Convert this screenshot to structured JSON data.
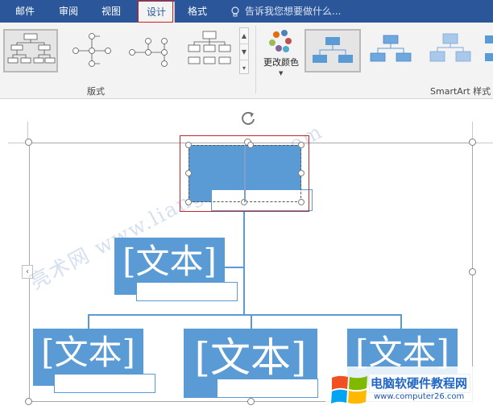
{
  "tabs": [
    {
      "label": "邮件",
      "active": false
    },
    {
      "label": "审阅",
      "active": false
    },
    {
      "label": "视图",
      "active": false
    },
    {
      "label": "设计",
      "active": true
    },
    {
      "label": "格式",
      "active": false
    }
  ],
  "tell_me": {
    "placeholder": "告诉我您想要做什么..."
  },
  "ribbon": {
    "layouts_group_label": "版式",
    "change_colors_label": "更改颜色",
    "styles_group_label": "SmartArt 样式"
  },
  "diagram": {
    "top_text": "",
    "mid_text": "[文本]",
    "bottom_texts": [
      "[文本]",
      "[文本]",
      "[文本]"
    ]
  },
  "watermark": {
    "text": "亮术网 www.liangshunet.com"
  },
  "logo": {
    "title": "电脑软硬件教程网",
    "url": "www.computer26.com"
  },
  "colors": {
    "ribbon_blue": "#2b579a",
    "shape_fill": "#5b9bd5",
    "highlight_red": "#d41c1c"
  }
}
